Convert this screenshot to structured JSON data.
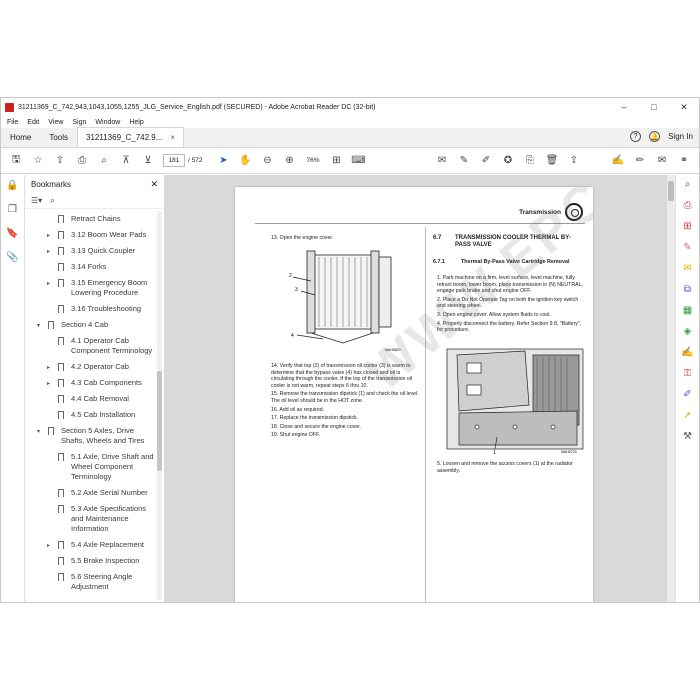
{
  "window": {
    "title": "31211369_C_742,943,1043,1055,1255_JLG_Service_English.pdf (SECURED) - Adobe Acrobat Reader DC (32-bit)",
    "controls": [
      "–",
      "□",
      "✕"
    ]
  },
  "menu": [
    "File",
    "Edit",
    "View",
    "Sign",
    "Window",
    "Help"
  ],
  "tabs": {
    "home": "Home",
    "tools": "Tools",
    "document": "31211369_C_742.9...",
    "close": "×",
    "help": "?",
    "sign_in": "Sign In"
  },
  "toolbar": {
    "page_current": "181",
    "page_total": "/ 572",
    "zoom": "76%"
  },
  "bookmarks": {
    "title": "Bookmarks",
    "close": "✕",
    "items": [
      {
        "label": "Retract Chains",
        "level": 2,
        "caret": ""
      },
      {
        "label": "3.12 Boom Wear Pads",
        "level": 1,
        "caret": "▸"
      },
      {
        "label": "3.13 Quick Coupler",
        "level": 1,
        "caret": "▸"
      },
      {
        "label": "3.14 Forks",
        "level": 1,
        "caret": ""
      },
      {
        "label": "3.15 Emergency Boom Lowering Procedure",
        "level": 1,
        "caret": "▸"
      },
      {
        "label": "3.16 Troubleshooting",
        "level": 1,
        "caret": ""
      },
      {
        "label": "Section 4 Cab",
        "level": 0,
        "caret": "▾"
      },
      {
        "label": "4.1 Operator Cab Component Terminology",
        "level": 1,
        "caret": ""
      },
      {
        "label": "4.2 Operator Cab",
        "level": 1,
        "caret": "▸"
      },
      {
        "label": "4.3 Cab Components",
        "level": 1,
        "caret": "▸"
      },
      {
        "label": "4.4 Cab Removal",
        "level": 1,
        "caret": ""
      },
      {
        "label": "4.5 Cab Installation",
        "level": 1,
        "caret": ""
      },
      {
        "label": "Section 5 Axles, Drive Shafts, Wheels and Tires",
        "level": 0,
        "caret": "▾"
      },
      {
        "label": "5.1 Axle, Drive Shaft and Wheel Component Terminology",
        "level": 1,
        "caret": ""
      },
      {
        "label": "5.2 Axle Serial Number",
        "level": 1,
        "caret": ""
      },
      {
        "label": "5.3 Axle Specifications and Maintenance Information",
        "level": 1,
        "caret": ""
      },
      {
        "label": "5.4 Axle Replacement",
        "level": 1,
        "caret": "▸"
      },
      {
        "label": "5.5 Brake Inspection",
        "level": 1,
        "caret": ""
      },
      {
        "label": "5.6 Steering Angle Adjustment",
        "level": 1,
        "caret": ""
      }
    ]
  },
  "page": {
    "header": "Transmission",
    "left_steps_top": "13.  Open the engine cover.",
    "fig1_code": "MAH0820",
    "fig1_callouts": [
      "2",
      "3",
      "4"
    ],
    "left_steps": [
      "14.  Verify that top (2) of transmission oil cooler (3) is warm to determine that the bypass valve (4) has closed and oil is circulating through the cooler. If the top of the transmission oil cooler is not warm, repeat steps 6 thru 10.",
      "15.  Remove the transmission dipstick (1) and check the oil level. The oil level should be in the HOT zone.",
      "16.  Add oil as required.",
      "17.  Replace the transmission dipstick.",
      "18.  Close and secure the engine cover.",
      "19.  Shut engine OFF."
    ],
    "section_num": "6.7",
    "section_title": "TRANSMISSION COOLER THERMAL BY-PASS VALVE",
    "subsection_num": "6.7.1",
    "subsection_title": "Thermal By-Pass Valve Cartridge Removal",
    "right_steps": [
      "1.  Park machine on a firm, level surface, level machine, fully retract boom, lower boom, place transmission in (N) NEUTRAL, engage park brake and shut engine OFF.",
      "2.  Place a Do Not Operate Tag on both the ignition key switch and steering wheel.",
      "3.  Open engine cover. Allow system fluids to cool.",
      "4.  Properly disconnect the battery. Refer Section 9.8, \"Battery\", for procedure."
    ],
    "fig2_code": "MAH0723",
    "fig2_callout": "1",
    "right_step_5": "5.  Loosen and remove the access covers (1) at the radiator assembly."
  },
  "watermark": "WWW.EPCDEPOT.COM"
}
